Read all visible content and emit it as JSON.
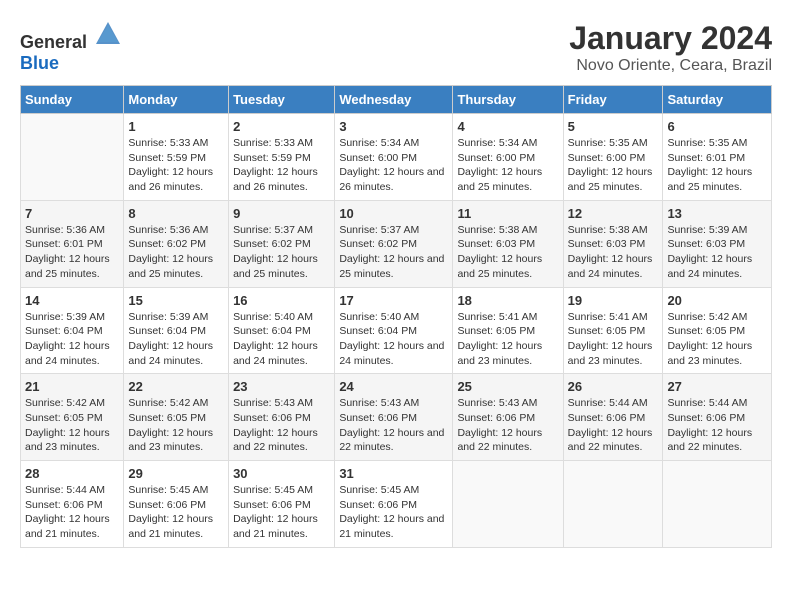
{
  "logo": {
    "text_general": "General",
    "text_blue": "Blue"
  },
  "title": "January 2024",
  "subtitle": "Novo Oriente, Ceara, Brazil",
  "days_of_week": [
    "Sunday",
    "Monday",
    "Tuesday",
    "Wednesday",
    "Thursday",
    "Friday",
    "Saturday"
  ],
  "weeks": [
    [
      {
        "day": "",
        "sunrise": "",
        "sunset": "",
        "daylight": ""
      },
      {
        "day": "1",
        "sunrise": "Sunrise: 5:33 AM",
        "sunset": "Sunset: 5:59 PM",
        "daylight": "Daylight: 12 hours and 26 minutes."
      },
      {
        "day": "2",
        "sunrise": "Sunrise: 5:33 AM",
        "sunset": "Sunset: 5:59 PM",
        "daylight": "Daylight: 12 hours and 26 minutes."
      },
      {
        "day": "3",
        "sunrise": "Sunrise: 5:34 AM",
        "sunset": "Sunset: 6:00 PM",
        "daylight": "Daylight: 12 hours and 26 minutes."
      },
      {
        "day": "4",
        "sunrise": "Sunrise: 5:34 AM",
        "sunset": "Sunset: 6:00 PM",
        "daylight": "Daylight: 12 hours and 25 minutes."
      },
      {
        "day": "5",
        "sunrise": "Sunrise: 5:35 AM",
        "sunset": "Sunset: 6:00 PM",
        "daylight": "Daylight: 12 hours and 25 minutes."
      },
      {
        "day": "6",
        "sunrise": "Sunrise: 5:35 AM",
        "sunset": "Sunset: 6:01 PM",
        "daylight": "Daylight: 12 hours and 25 minutes."
      }
    ],
    [
      {
        "day": "7",
        "sunrise": "Sunrise: 5:36 AM",
        "sunset": "Sunset: 6:01 PM",
        "daylight": "Daylight: 12 hours and 25 minutes."
      },
      {
        "day": "8",
        "sunrise": "Sunrise: 5:36 AM",
        "sunset": "Sunset: 6:02 PM",
        "daylight": "Daylight: 12 hours and 25 minutes."
      },
      {
        "day": "9",
        "sunrise": "Sunrise: 5:37 AM",
        "sunset": "Sunset: 6:02 PM",
        "daylight": "Daylight: 12 hours and 25 minutes."
      },
      {
        "day": "10",
        "sunrise": "Sunrise: 5:37 AM",
        "sunset": "Sunset: 6:02 PM",
        "daylight": "Daylight: 12 hours and 25 minutes."
      },
      {
        "day": "11",
        "sunrise": "Sunrise: 5:38 AM",
        "sunset": "Sunset: 6:03 PM",
        "daylight": "Daylight: 12 hours and 25 minutes."
      },
      {
        "day": "12",
        "sunrise": "Sunrise: 5:38 AM",
        "sunset": "Sunset: 6:03 PM",
        "daylight": "Daylight: 12 hours and 24 minutes."
      },
      {
        "day": "13",
        "sunrise": "Sunrise: 5:39 AM",
        "sunset": "Sunset: 6:03 PM",
        "daylight": "Daylight: 12 hours and 24 minutes."
      }
    ],
    [
      {
        "day": "14",
        "sunrise": "Sunrise: 5:39 AM",
        "sunset": "Sunset: 6:04 PM",
        "daylight": "Daylight: 12 hours and 24 minutes."
      },
      {
        "day": "15",
        "sunrise": "Sunrise: 5:39 AM",
        "sunset": "Sunset: 6:04 PM",
        "daylight": "Daylight: 12 hours and 24 minutes."
      },
      {
        "day": "16",
        "sunrise": "Sunrise: 5:40 AM",
        "sunset": "Sunset: 6:04 PM",
        "daylight": "Daylight: 12 hours and 24 minutes."
      },
      {
        "day": "17",
        "sunrise": "Sunrise: 5:40 AM",
        "sunset": "Sunset: 6:04 PM",
        "daylight": "Daylight: 12 hours and 24 minutes."
      },
      {
        "day": "18",
        "sunrise": "Sunrise: 5:41 AM",
        "sunset": "Sunset: 6:05 PM",
        "daylight": "Daylight: 12 hours and 23 minutes."
      },
      {
        "day": "19",
        "sunrise": "Sunrise: 5:41 AM",
        "sunset": "Sunset: 6:05 PM",
        "daylight": "Daylight: 12 hours and 23 minutes."
      },
      {
        "day": "20",
        "sunrise": "Sunrise: 5:42 AM",
        "sunset": "Sunset: 6:05 PM",
        "daylight": "Daylight: 12 hours and 23 minutes."
      }
    ],
    [
      {
        "day": "21",
        "sunrise": "Sunrise: 5:42 AM",
        "sunset": "Sunset: 6:05 PM",
        "daylight": "Daylight: 12 hours and 23 minutes."
      },
      {
        "day": "22",
        "sunrise": "Sunrise: 5:42 AM",
        "sunset": "Sunset: 6:05 PM",
        "daylight": "Daylight: 12 hours and 23 minutes."
      },
      {
        "day": "23",
        "sunrise": "Sunrise: 5:43 AM",
        "sunset": "Sunset: 6:06 PM",
        "daylight": "Daylight: 12 hours and 22 minutes."
      },
      {
        "day": "24",
        "sunrise": "Sunrise: 5:43 AM",
        "sunset": "Sunset: 6:06 PM",
        "daylight": "Daylight: 12 hours and 22 minutes."
      },
      {
        "day": "25",
        "sunrise": "Sunrise: 5:43 AM",
        "sunset": "Sunset: 6:06 PM",
        "daylight": "Daylight: 12 hours and 22 minutes."
      },
      {
        "day": "26",
        "sunrise": "Sunrise: 5:44 AM",
        "sunset": "Sunset: 6:06 PM",
        "daylight": "Daylight: 12 hours and 22 minutes."
      },
      {
        "day": "27",
        "sunrise": "Sunrise: 5:44 AM",
        "sunset": "Sunset: 6:06 PM",
        "daylight": "Daylight: 12 hours and 22 minutes."
      }
    ],
    [
      {
        "day": "28",
        "sunrise": "Sunrise: 5:44 AM",
        "sunset": "Sunset: 6:06 PM",
        "daylight": "Daylight: 12 hours and 21 minutes."
      },
      {
        "day": "29",
        "sunrise": "Sunrise: 5:45 AM",
        "sunset": "Sunset: 6:06 PM",
        "daylight": "Daylight: 12 hours and 21 minutes."
      },
      {
        "day": "30",
        "sunrise": "Sunrise: 5:45 AM",
        "sunset": "Sunset: 6:06 PM",
        "daylight": "Daylight: 12 hours and 21 minutes."
      },
      {
        "day": "31",
        "sunrise": "Sunrise: 5:45 AM",
        "sunset": "Sunset: 6:06 PM",
        "daylight": "Daylight: 12 hours and 21 minutes."
      },
      {
        "day": "",
        "sunrise": "",
        "sunset": "",
        "daylight": ""
      },
      {
        "day": "",
        "sunrise": "",
        "sunset": "",
        "daylight": ""
      },
      {
        "day": "",
        "sunrise": "",
        "sunset": "",
        "daylight": ""
      }
    ]
  ]
}
